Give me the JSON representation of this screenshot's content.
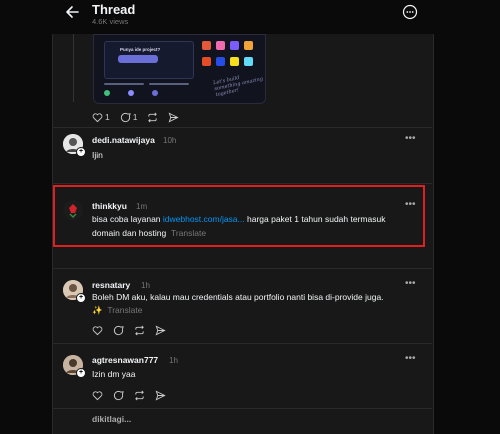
{
  "header": {
    "title": "Thread",
    "views": "4.6K views"
  },
  "top_post": {
    "image": {
      "card_heading": "Punya ide project?",
      "script_text": "Let's build something amazing together!"
    },
    "likes": "1",
    "replies": "1"
  },
  "replies": [
    {
      "username": "dedi.natawijaya",
      "time": "10h",
      "text": "Ijin",
      "avatar_color": "#d9d9d9"
    },
    {
      "username": "thinkkyu",
      "time": "1m",
      "text_before": "bisa coba layanan ",
      "link": "idwebhost.com/jasa...",
      "text_after": " harga paket 1 tahun sudah termasuk",
      "line2": "domain dan hosting",
      "translate": "Translate",
      "avatar_color": "#1a1a1a",
      "highlight_color": "#e02020"
    },
    {
      "username": "resnatary",
      "time": "1h",
      "line1": "Boleh DM aku, kalau mau credentials atau portfolio nanti bisa di-provide juga.",
      "emoji": "✨",
      "translate": "Translate",
      "avatar_color": "#c9b6a0"
    },
    {
      "username": "agtresnawan777",
      "time": "1h",
      "text": "Izin dm yaa",
      "avatar_color": "#b7a493"
    }
  ],
  "partial_bottom": {
    "username_fragment": "dikitlagi..."
  },
  "more_label": "•••",
  "colors": {
    "background": "#0a0a0a",
    "panel": "#181818",
    "link": "#0095f6",
    "highlight": "#e02020"
  }
}
